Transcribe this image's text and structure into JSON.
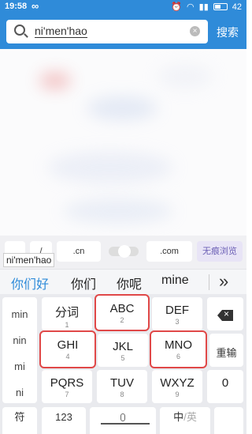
{
  "status_bar": {
    "time": "19:58",
    "infinity": "∞",
    "battery": "42"
  },
  "search": {
    "query": "ni'men'hao",
    "button": "搜索",
    "clear": "×"
  },
  "url_row": {
    "slash": "/",
    "cn": ".cn",
    "com": ".com",
    "incognito": "无痕浏览"
  },
  "pinyin_preview": "ni'men'hao",
  "candidates": [
    "你们好",
    "你们",
    "你呢",
    "mine"
  ],
  "more_symbol": "»",
  "keyboard": {
    "left_list": [
      "min",
      "nin",
      "mi",
      "ni"
    ],
    "keys": [
      {
        "letters": "分词",
        "num": "1"
      },
      {
        "letters": "ABC",
        "num": "2"
      },
      {
        "letters": "DEF",
        "num": "3"
      },
      {
        "letters": "GHI",
        "num": "4"
      },
      {
        "letters": "JKL",
        "num": "5"
      },
      {
        "letters": "MNO",
        "num": "6"
      },
      {
        "letters": "PQRS",
        "num": "7"
      },
      {
        "letters": "TUV",
        "num": "8"
      },
      {
        "letters": "WXYZ",
        "num": "9"
      }
    ],
    "reinput": "重输",
    "zero": "0",
    "bottom": {
      "symbol": "符",
      "num": "123",
      "lang": "中",
      "lang_sep": "/",
      "en": "英"
    }
  }
}
